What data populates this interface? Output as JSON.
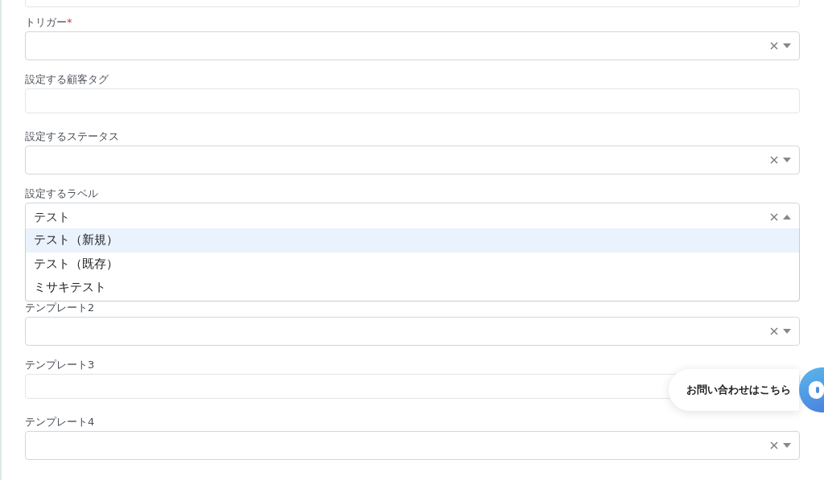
{
  "fields": [
    {
      "kind": "cut_input"
    },
    {
      "kind": "select",
      "label": "トリガー",
      "required_mark": "*"
    },
    {
      "kind": "input",
      "label": "設定する顧客タグ"
    },
    {
      "kind": "select",
      "label": "設定するステータス"
    },
    {
      "kind": "select",
      "label": "設定するラベル",
      "expanded": true,
      "value": "テスト",
      "options": [
        {
          "text": "テスト（新規）",
          "selected": true
        },
        {
          "text": "テスト（既存）",
          "selected": false
        },
        {
          "text": "ミサキテスト",
          "selected": false
        }
      ]
    },
    {
      "kind": "hidden"
    },
    {
      "kind": "select",
      "label": "テンプレート2"
    },
    {
      "kind": "input",
      "label": "テンプレート3"
    },
    {
      "kind": "select",
      "label": "テンプレート4"
    }
  ],
  "chat": {
    "label": "お問い合わせはこちら"
  }
}
